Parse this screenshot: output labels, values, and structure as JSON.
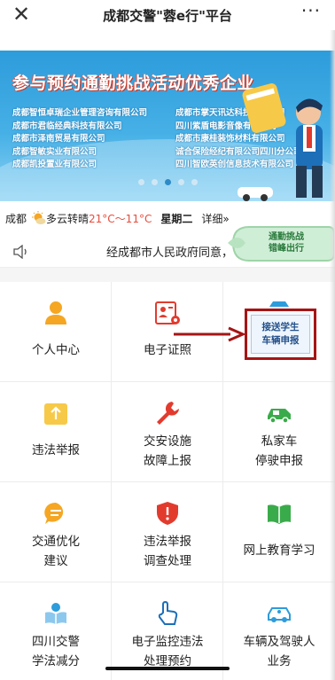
{
  "header": {
    "close": "✕",
    "title": "成都交警\"蓉e行\"平台",
    "more": "···"
  },
  "banner": {
    "headline": "参与预约通勤挑战活动优秀企业",
    "companies_left": [
      "成都智恒卓瑞企业管理咨询有限公司",
      "成都市君临经典科技有限公司",
      "成都市泽南贸易有限公司",
      "成都智敏实业有限公司",
      "成都凯投置业有限公司"
    ],
    "companies_right": [
      "成都市掌天讯达科技有限公司",
      "四川紫盾电影音像有限公司",
      "成都市康桂装饰材料有限公司",
      "诚合保险经纪有限公司四川分公司",
      "四川智欧英创信息技术有限公司"
    ],
    "slide_count": 5,
    "active_slide": 2
  },
  "weather": {
    "city": "成都",
    "condition": "多云转晴",
    "temp": "21°C～11°C",
    "day": "星期二",
    "detail": "详细»"
  },
  "float_badge": {
    "line1": "通勤挑战",
    "line2": "错峰出行"
  },
  "notice": {
    "text": "经成都市人民政府同意，"
  },
  "grid": [
    {
      "label1": "个人中心",
      "label2": ""
    },
    {
      "label1": "电子证照",
      "label2": ""
    },
    {
      "label1": "",
      "label2": ""
    },
    {
      "label1": "违法举报",
      "label2": ""
    },
    {
      "label1": "交安设施",
      "label2": "故障上报"
    },
    {
      "label1": "私家车",
      "label2": "停驶申报"
    },
    {
      "label1": "交通优化",
      "label2": "建议"
    },
    {
      "label1": "违法举报",
      "label2": "调查处理"
    },
    {
      "label1": "网上教育学习",
      "label2": ""
    },
    {
      "label1": "四川交警",
      "label2": "学法减分"
    },
    {
      "label1": "电子监控违法",
      "label2": "处理预约"
    },
    {
      "label1": "车辆及驾驶人",
      "label2": "业务"
    }
  ],
  "float_card": {
    "line1": "接送学生",
    "line2": "车辆申报"
  },
  "colors": {
    "orange": "#f5a623",
    "red": "#e23b2e",
    "green": "#3aab4a",
    "blue": "#2d9cdb",
    "highlight": "#a51414"
  }
}
